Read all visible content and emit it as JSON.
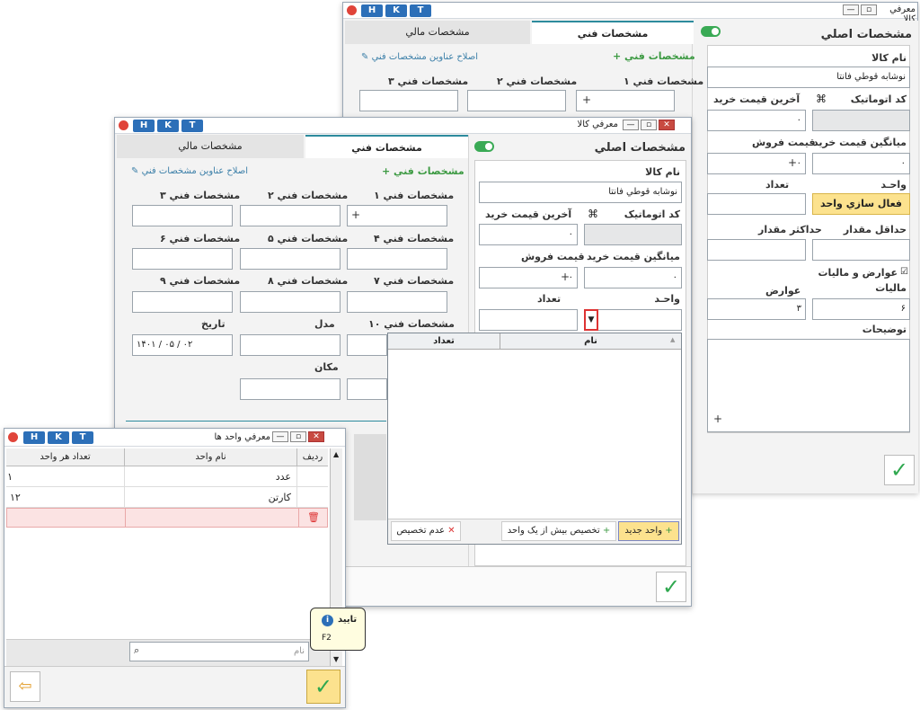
{
  "hkt": [
    "H",
    "K",
    "T"
  ],
  "window_back": {
    "title": "معرفي کالا",
    "main_section": "مشخصات اصلي",
    "tab_technical": "مشخصات فني",
    "tab_financial": "مشخصات مالي",
    "tech_header": "مشخصات فني",
    "edit_titles_link": "اصلاح عناوين مشخصات فني",
    "product_name_label": "نام کالا",
    "product_name_value": "نوشابه قوطي فانتا",
    "auto_code_label": "کد اتوماتيک",
    "last_price_label": "آخرين قيمت خريد",
    "last_price_value": "۰",
    "avg_price_label": "ميانگين قيمت خريد",
    "avg_price_value": "۰",
    "sale_price_label": "قيمت فروش",
    "sale_price_value": "۰",
    "unit_label": "واحـد",
    "qty_label": "تعداد",
    "activate_unit_button": "فعال سازي واحد",
    "min_qty_label": "حداقل مقدار",
    "max_qty_label": "حداکثر مقدار",
    "duties_check_label": "عوارض و ماليات",
    "tax_label": "ماليات",
    "tax_value": "۶",
    "duties_label": "عوارض",
    "duties_value": "۳",
    "description_label": "توضيحات",
    "tech_specs": [
      "مشخصات فني ۱",
      "مشخصات فني ۲",
      "مشخصات فني ۳"
    ]
  },
  "window_mid": {
    "title": "معرفي کالا",
    "main_section": "مشخصات اصلي",
    "tab_technical": "مشخصات فني",
    "tab_financial": "مشخصات مالي",
    "tech_header": "مشخصات فني",
    "edit_titles_link": "اصلاح عناوين مشخصات فني",
    "product_name_label": "نام کالا",
    "product_name_value": "نوشابه قوطي فانتا",
    "auto_code_label": "کد اتوماتيک",
    "last_price_label": "آخرين قيمت خريد",
    "last_price_value": "۰",
    "avg_price_label": "ميانگين قيمت خريد",
    "avg_price_value": "۰",
    "sale_price_label": "قيمت فروش",
    "sale_price_value": "۰",
    "unit_label": "واحـد",
    "qty_label": "تعداد",
    "tech_specs": [
      "مشخصات فني ۱",
      "مشخصات فني ۲",
      "مشخصات فني ۳",
      "مشخصات فني ۴",
      "مشخصات فني ۵",
      "مشخصات فني ۶",
      "مشخصات فني ۷",
      "مشخصات فني ۸",
      "مشخصات فني ۹",
      "مشخصات فني ۱۰"
    ],
    "model_label": "مدل",
    "date_label": "تاريخ",
    "date_value": "۱۴۰۱ / ۰۵ / ۰۲",
    "place_label": "مکان",
    "dropdown_col_name": "نام",
    "dropdown_col_qty": "تعداد",
    "new_unit_button": "واحد جديد",
    "multi_assign_button": "تخصيص بيش از يک واحد",
    "no_assign_button": "عدم تخصيص"
  },
  "window_units": {
    "title": "معرفي واحد ها",
    "col_row": "رديف",
    "col_unit_name": "نام واحد",
    "col_per_unit": "تعداد هر واحد",
    "rows": [
      {
        "name": "عدد",
        "count": "۱"
      },
      {
        "name": "کارتن",
        "count": "۱۲"
      }
    ],
    "search_placeholder": "نام",
    "tooltip_title": "تاييد",
    "tooltip_key": "F2"
  }
}
